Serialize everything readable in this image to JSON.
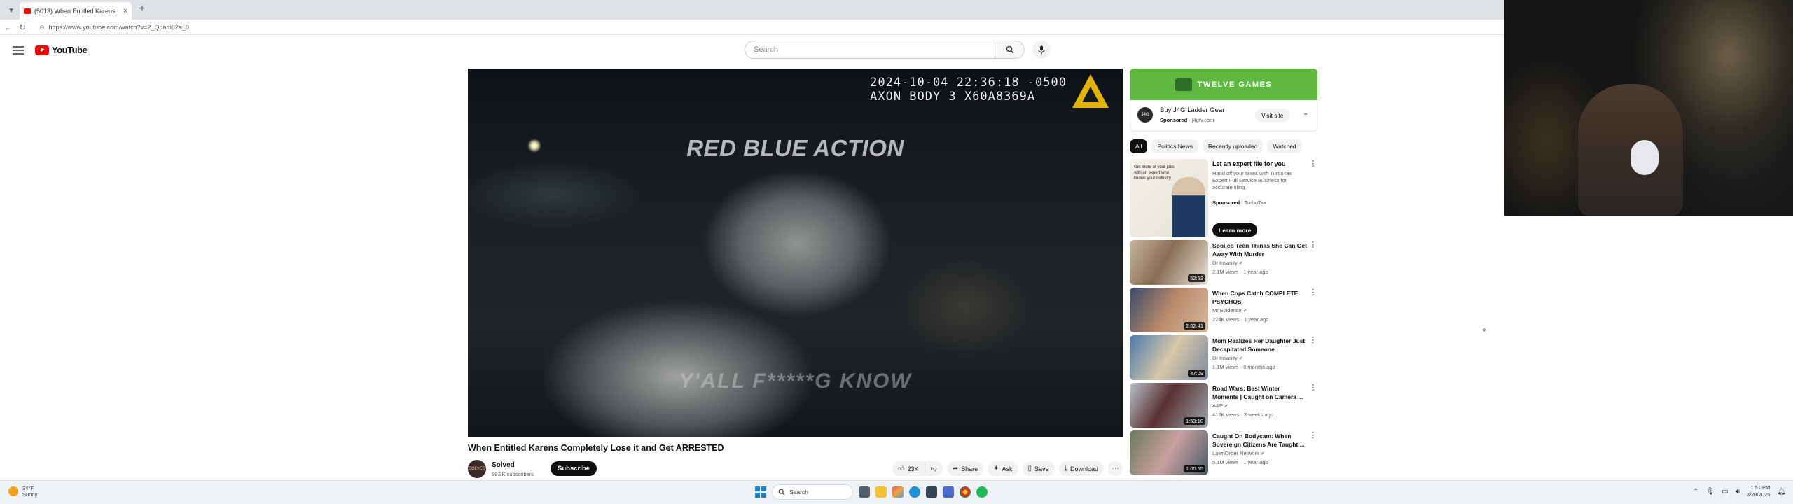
{
  "browser": {
    "tab_title": "(5013) When Entitled Karens",
    "url": "https://www.youtube.com/watch?v=2_Qpam82a_0"
  },
  "header": {
    "logo_text": "YouTube",
    "search_placeholder": "Search"
  },
  "player": {
    "timestamp_line1": "2024-10-04 22:36:18 -0500",
    "timestamp_line2": "AXON BODY 3 X60A8369A",
    "overlay_title": "RED BLUE ACTION",
    "overlay_caption": "Y'ALL F*****G KNOW"
  },
  "video": {
    "title": "When Entitled Karens Completely Lose it and Get ARRESTED",
    "channel_name": "Solved",
    "subscribers": "98.3K subscribers",
    "avatar_text": "SOLVED",
    "subscribe_label": "Subscribe",
    "likes": "23K",
    "share_label": "Share",
    "ask_label": "Ask",
    "save_label": "Save",
    "download_label": "Download"
  },
  "sidebar": {
    "ad": {
      "banner_text": "TWELVE GAMES",
      "avatar_text": "J4G",
      "title": "Buy J4G Ladder Gear",
      "sponsored": "Sponsored",
      "domain": "j4gtv.com",
      "visit_label": "Visit site"
    },
    "chips": [
      "All",
      "Politics News",
      "Recently uploaded",
      "Watched"
    ],
    "sponsored_video": {
      "thumb_text": "Get more of your jobs with an expert who knows your industry",
      "title": "Let an expert file for you",
      "description": "Hand off your taxes with TurboTax Expert Full Service Business for accurate filing.",
      "sponsored": "Sponsored",
      "advertiser": "TurboTax",
      "cta": "Learn more"
    },
    "videos": [
      {
        "title": "Spoiled Teen Thinks She Can Get Away With Murder",
        "channel": "Dr Insanity",
        "meta": "2.1M views · 1 year ago",
        "duration": "52:53",
        "thumb": "thumb-1"
      },
      {
        "title": "When Cops Catch COMPLETE PSYCHOS",
        "channel": "Mr Evidence",
        "meta": "224K views · 1 year ago",
        "duration": "2:02:41",
        "thumb": "thumb-2"
      },
      {
        "title": "Mom Realizes Her Daughter Just Decapitated Someone",
        "channel": "Dr Insanity",
        "meta": "1.1M views · 8 months ago",
        "duration": "47:09",
        "thumb": "thumb-3"
      },
      {
        "title": "Road Wars: Best Winter Moments | Caught on Camera ...",
        "channel": "A&E",
        "meta": "412K views · 3 weeks ago",
        "duration": "1:53:10",
        "thumb": "thumb-4"
      },
      {
        "title": "Caught On Bodycam: When Sovereign Citizens Are Taught ...",
        "channel": "LawnOrder Network",
        "meta": "5.1M views · 1 year ago",
        "duration": "1:00:55",
        "thumb": "thumb-5"
      }
    ]
  },
  "taskbar": {
    "temp": "34°F",
    "condition": "Sunny",
    "search_label": "Search",
    "time": "1:51 PM",
    "date": "3/28/2025"
  },
  "colors": {
    "youtube_red": "#ff0000",
    "ad_green": "#5fb83f",
    "axon_yellow": "#e2b400"
  }
}
